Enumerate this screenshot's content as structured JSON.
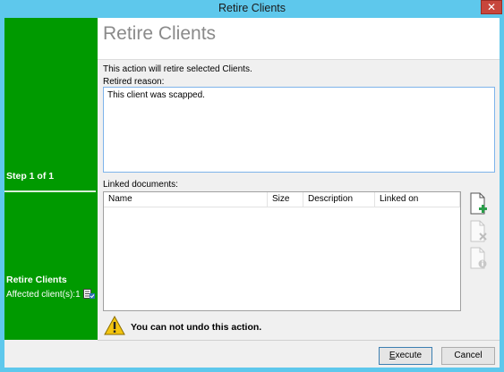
{
  "window": {
    "title": "Retire Clients",
    "close_glyph": "✕"
  },
  "sidebar": {
    "step": "Step 1 of 1",
    "section_title": "Retire Clients",
    "affected": "Affected client(s):1",
    "icon": "client-list-icon",
    "color": "#009a00"
  },
  "main": {
    "title": "Retire Clients",
    "description": "This action will retire selected Clients.",
    "reason_label": "Retired reason:",
    "reason_value": "This client was scapped.",
    "linked_label": "Linked documents:",
    "columns": [
      "Name",
      "Size",
      "Description",
      "Linked on"
    ],
    "rows": [],
    "actions": [
      "add-document-icon",
      "remove-document-icon",
      "document-info-icon"
    ],
    "warning": "You can not undo this action.",
    "warning_icon": "warning-icon"
  },
  "footer": {
    "execute_label": "Execute",
    "execute_accel": "E",
    "execute_rest": "xecute",
    "cancel_label": "Cancel"
  },
  "colors": {
    "title_bar": "#5ec8ec",
    "accent_green": "#009a00",
    "focus_border": "#7eb4ea",
    "close_red": "#c7463c"
  }
}
